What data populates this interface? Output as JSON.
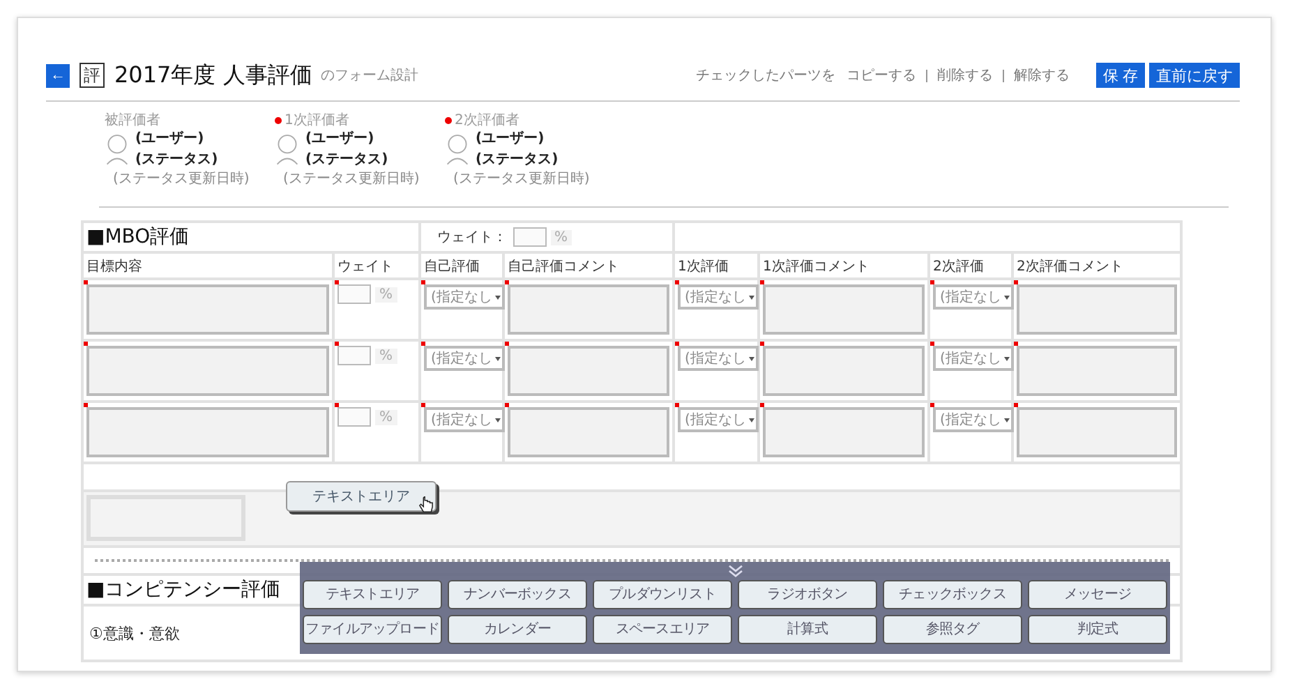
{
  "header": {
    "back_button": "←",
    "form_icon": "評",
    "title": "2017年度 人事評価",
    "subtitle": "のフォーム設計"
  },
  "actions": {
    "prefix": "チェックしたパーツを",
    "links": [
      "コピーする",
      "削除する",
      "解除する"
    ]
  },
  "buttons": [
    "保 存",
    "直前に戻す"
  ],
  "evaluators": [
    {
      "role": "被評価者",
      "required": false,
      "user": "(ユーザー)",
      "status": "(ステータス)",
      "updated": "(ステータス更新日時)"
    },
    {
      "role": "1次評価者",
      "required": true,
      "user": "(ユーザー)",
      "status": "(ステータス)",
      "updated": "(ステータス更新日時)"
    },
    {
      "role": "2次評価者",
      "required": true,
      "user": "(ユーザー)",
      "status": "(ステータス)",
      "updated": "(ステータス更新日時)"
    }
  ],
  "mbo": {
    "title": "■MBO評価",
    "weight_label": "ウェイト：",
    "weight_unit": "%",
    "columns": [
      "目標内容",
      "ウェイト",
      "自己評価",
      "自己評価コメント",
      "1次評価",
      "1次評価コメント",
      "2次評価",
      "2次評価コメント"
    ],
    "rows": [
      {
        "required": true,
        "unit": "%",
        "self": "(指定なし",
        "first": "(指定なし",
        "second": "(指定なし"
      },
      {
        "required": true,
        "unit": "%",
        "self": "(指定なし",
        "first": "(指定なし",
        "second": "(指定なし"
      },
      {
        "required": true,
        "unit": "%",
        "self": "(指定なし",
        "first": "(指定なし",
        "second": "(指定なし"
      }
    ]
  },
  "drag": {
    "ghost": "テキストエリア"
  },
  "competency": {
    "title": "■コンピテンシー評価",
    "items": [
      "①意識・意欲"
    ]
  },
  "palette": {
    "buttons": [
      "テキストエリア",
      "ナンバーボックス",
      "プルダウンリスト",
      "ラジオボタン",
      "チェックボックス",
      "メッセージ",
      "ファイルアップロード",
      "カレンダー",
      "スペースエリア",
      "計算式",
      "参照タグ",
      "判定式"
    ]
  }
}
